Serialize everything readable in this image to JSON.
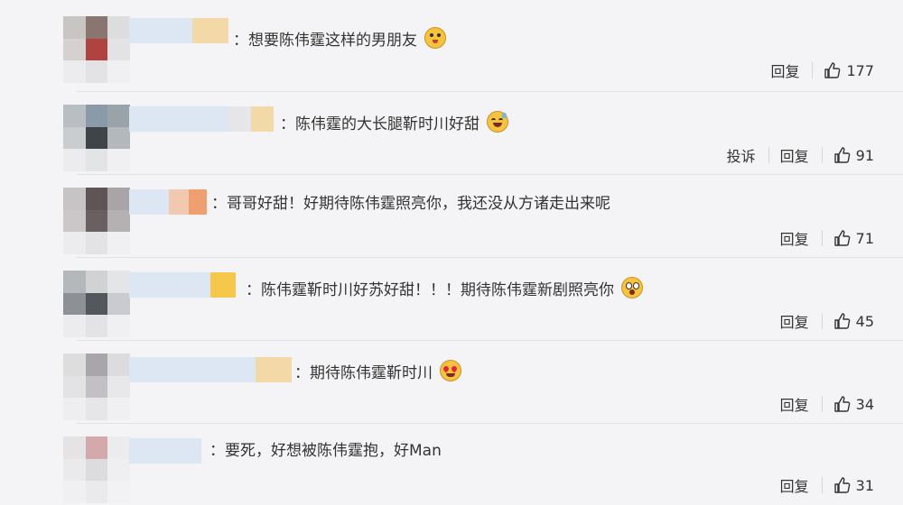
{
  "comments": [
    {
      "text": "想要陈伟霆这样的男朋友",
      "emoji": "cat-face-emoji",
      "reply_label": "回复",
      "likes": "177"
    },
    {
      "text": "陈伟霆的大长腿靳时川好甜",
      "emoji": "sweat-laugh-emoji",
      "report_label": "投诉",
      "reply_label": "回复",
      "likes": "91"
    },
    {
      "text": "哥哥好甜！好期待陈伟霆照亮你，我还没从方诸走出来呢",
      "reply_label": "回复",
      "likes": "71"
    },
    {
      "text": "陈伟霆靳时川好苏好甜！！！期待陈伟霆新剧照亮你",
      "emoji": "shocked-face-emoji",
      "reply_label": "回复",
      "likes": "45"
    },
    {
      "text": "期待陈伟霆靳时川",
      "emoji": "heart-eyes-emoji",
      "reply_label": "回复",
      "likes": "34"
    },
    {
      "text": "要死，好想被陈伟霆抱，好Man",
      "reply_label": "回复",
      "likes": "31"
    }
  ],
  "colors": {
    "background": "#f4f4f6",
    "text": "#333333",
    "divider": "#e2e2e6",
    "emoji_yellow": "#f7c23c"
  }
}
